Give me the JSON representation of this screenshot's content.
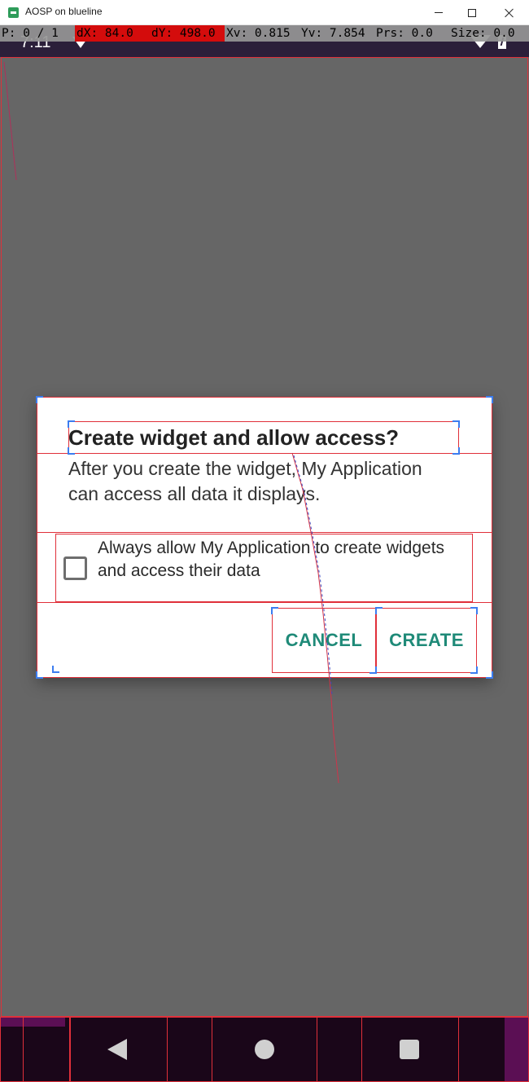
{
  "window": {
    "title": "AOSP on blueline"
  },
  "status_bar": {
    "time": "7:11"
  },
  "pointer_overlay": {
    "p": "P: 0 / 1",
    "dx": "dX: 84.0",
    "dy": "dY: 498.0",
    "xv": "Xv: 0.815",
    "yv": "Yv: 7.854",
    "prs": "Prs: 0.0",
    "size": "Size: 0.0"
  },
  "dialog": {
    "title": "Create widget and allow access?",
    "message": "After you create the widget, My Application can access all data it displays.",
    "checkbox_label": "Always allow My Application to create widgets and access their data",
    "checkbox_checked": false,
    "cancel_label": "CANCEL",
    "create_label": "CREATE",
    "accent_color": "#1f8a78"
  },
  "colors": {
    "scrim": "#666666",
    "status_bar": "#2b1f3a",
    "nav_bar": "#1a0619",
    "overlay_highlight": "#d40c0c"
  },
  "icons": {
    "status_left": "wifi-icon",
    "status_right": [
      "signal-icon",
      "battery-icon"
    ],
    "navigation": [
      "back-icon",
      "home-icon",
      "recents-icon"
    ]
  }
}
